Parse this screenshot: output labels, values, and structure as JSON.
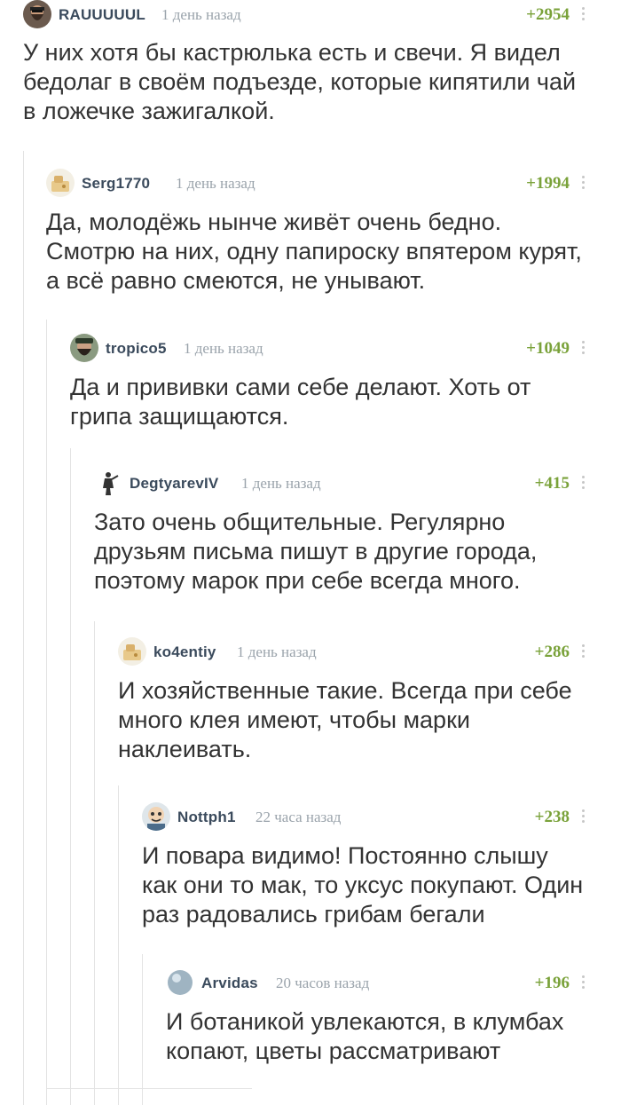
{
  "comments": [
    {
      "author": "RAUUUUUL",
      "time": "1 день назад",
      "rating": "+2954",
      "avatar": "bearded-man-avatar",
      "text": "У них хотя бы кастрюлька есть и свечи. Я видел бедолаг в своём подъезде, которые  кипятили чай в ложечке зажигалкой."
    },
    {
      "author": "Serg1770",
      "time": "1 день назад",
      "rating": "+1994",
      "avatar": "default-avatar",
      "text": "Да, молодёжь нынче живёт очень бедно. Смотрю на них, одну папироску впятером курят, а всё равно смеются, не унывают."
    },
    {
      "author": "tropico5",
      "time": "1 день назад",
      "rating": "+1049",
      "avatar": "bearded-man-avatar",
      "text": "Да и прививки сами себе делают. Хоть от грипа защищаются."
    },
    {
      "author": "DegtyarevIV",
      "time": "1 день назад",
      "rating": "+415",
      "avatar": "figure-avatar",
      "text": "Зато очень общительные. Регулярно друзьям письма пишут в другие города, поэтому марок при себе всегда много."
    },
    {
      "author": "ko4entiy",
      "time": "1 день назад",
      "rating": "+286",
      "avatar": "default-avatar",
      "text": "И хозяйственные такие. Всегда при себе много клея имеют, чтобы марки наклеивать."
    },
    {
      "author": "Nottph1",
      "time": "22 часа назад",
      "rating": "+238",
      "avatar": "cartoon-avatar",
      "text": "И повара видимо! Постоянно слышу как они то мак, то уксус покупают. Один раз радовались грибам бегали"
    },
    {
      "author": "Arvidas",
      "time": "20 часов назад",
      "rating": "+196",
      "avatar": "sphere-avatar",
      "text": "И ботаникой увлекаются, в клумбах копают, цветы рассматривают"
    }
  ]
}
